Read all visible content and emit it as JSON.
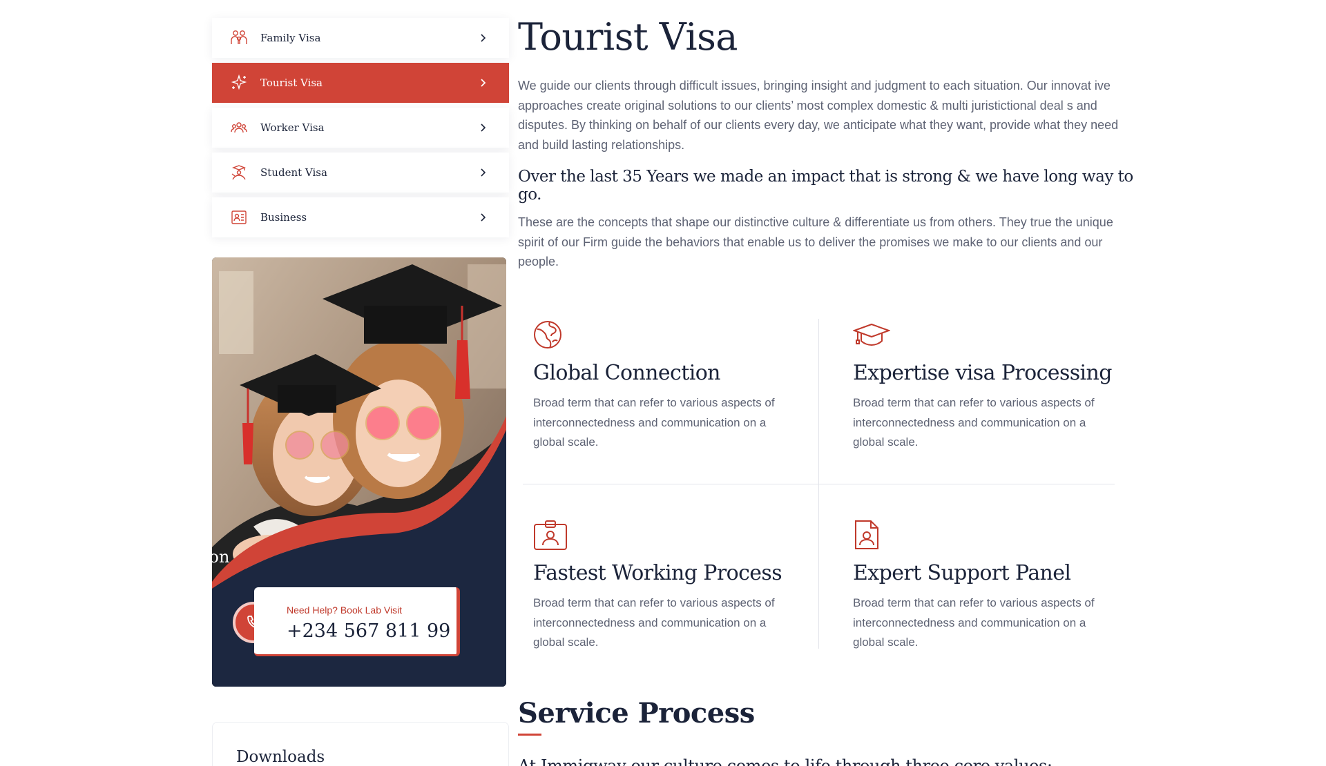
{
  "sidebar": {
    "items": [
      {
        "label": "Family Visa",
        "icon": "family-icon",
        "active": false
      },
      {
        "label": "Tourist Visa",
        "icon": "sparkle-icon",
        "active": true
      },
      {
        "label": "Worker Visa",
        "icon": "worker-group-icon",
        "active": false
      },
      {
        "label": "Student Visa",
        "icon": "student-icon",
        "active": false
      },
      {
        "label": "Business",
        "icon": "business-profile-icon",
        "active": false
      }
    ]
  },
  "promo": {
    "title": "Visa & Immigration",
    "help_label": "Need Help? Book Lab Visit",
    "phone": "+234 567 811 99"
  },
  "downloads": {
    "title": "Downloads"
  },
  "main": {
    "title": "Tourist Visa",
    "intro": "We guide our clients through difficult issues, bringing insight and judgment to each situation. Our innovat ive approaches create original solutions to our clients’ most complex domestic & multi juristictional deal s and disputes. By thinking on behalf of our clients every day, we anticipate what they want, provide what they need and build lasting relationships.",
    "impact": "Over the last 35 Years we made an impact that is strong & we have long way to go.",
    "concepts": "These are the concepts that shape our distinctive culture & differentiate us from others. They true the unique spirit of our Firm guide the behaviors that enable us to deliver the promises we make to our clients and our people."
  },
  "features": [
    {
      "title": "Global Connection",
      "text": "Broad term that can refer to various aspects of interconnectedness and communication on a global scale.",
      "icon": "globe-icon"
    },
    {
      "title": "Expertise visa Processing",
      "text": "Broad term that can refer to various aspects of interconnectedness and communication on a global scale.",
      "icon": "graduation-cap-icon"
    },
    {
      "title": "Fastest Working Process",
      "text": "Broad term that can refer to various aspects of interconnectedness and communication on a global scale.",
      "icon": "id-badge-icon"
    },
    {
      "title": "Expert Support Panel",
      "text": "Broad term that can refer to various aspects of interconnectedness and communication on a global scale.",
      "icon": "document-user-icon"
    }
  ],
  "service": {
    "title": "Service Process",
    "text": "At Immigway our culture comes to life through three core values:"
  },
  "colors": {
    "accent": "#d04437",
    "navy": "#1c2740",
    "body_text": "#5e6374",
    "heading": "#1b2339"
  }
}
